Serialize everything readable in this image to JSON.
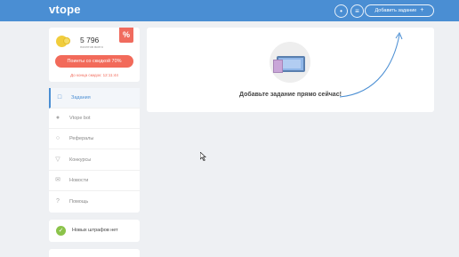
{
  "header": {
    "logo": "vtope",
    "add_task_label": "Добавить задание",
    "add_task_plus": "+",
    "icon_names": [
      "drop-icon",
      "menu-icon"
    ]
  },
  "balance": {
    "amount": "5 796",
    "caption": "поинтов всего",
    "badge": "%",
    "discount_button": "Поинты со скидкой 70%",
    "discount_timer": "До конца скидок: 12:11:44"
  },
  "sidebar": {
    "items": [
      {
        "label": "Задания",
        "icon": "document-icon",
        "active": true
      },
      {
        "label": "Vtope bot",
        "icon": "bot-icon",
        "active": false
      },
      {
        "label": "Рефералы",
        "icon": "user-icon",
        "active": false
      },
      {
        "label": "Конкурсы",
        "icon": "trophy-icon",
        "active": false
      },
      {
        "label": "Новости",
        "icon": "envelope-icon",
        "active": false
      },
      {
        "label": "Помощь",
        "icon": "help-icon",
        "active": false
      }
    ]
  },
  "fines": {
    "label": "Новых штрафов нет"
  },
  "main": {
    "empty_label": "Добавьте задание прямо сейчас!"
  },
  "colors": {
    "header": "#4a8ed3",
    "accent": "#f26a5a",
    "success": "#8bc34a"
  }
}
